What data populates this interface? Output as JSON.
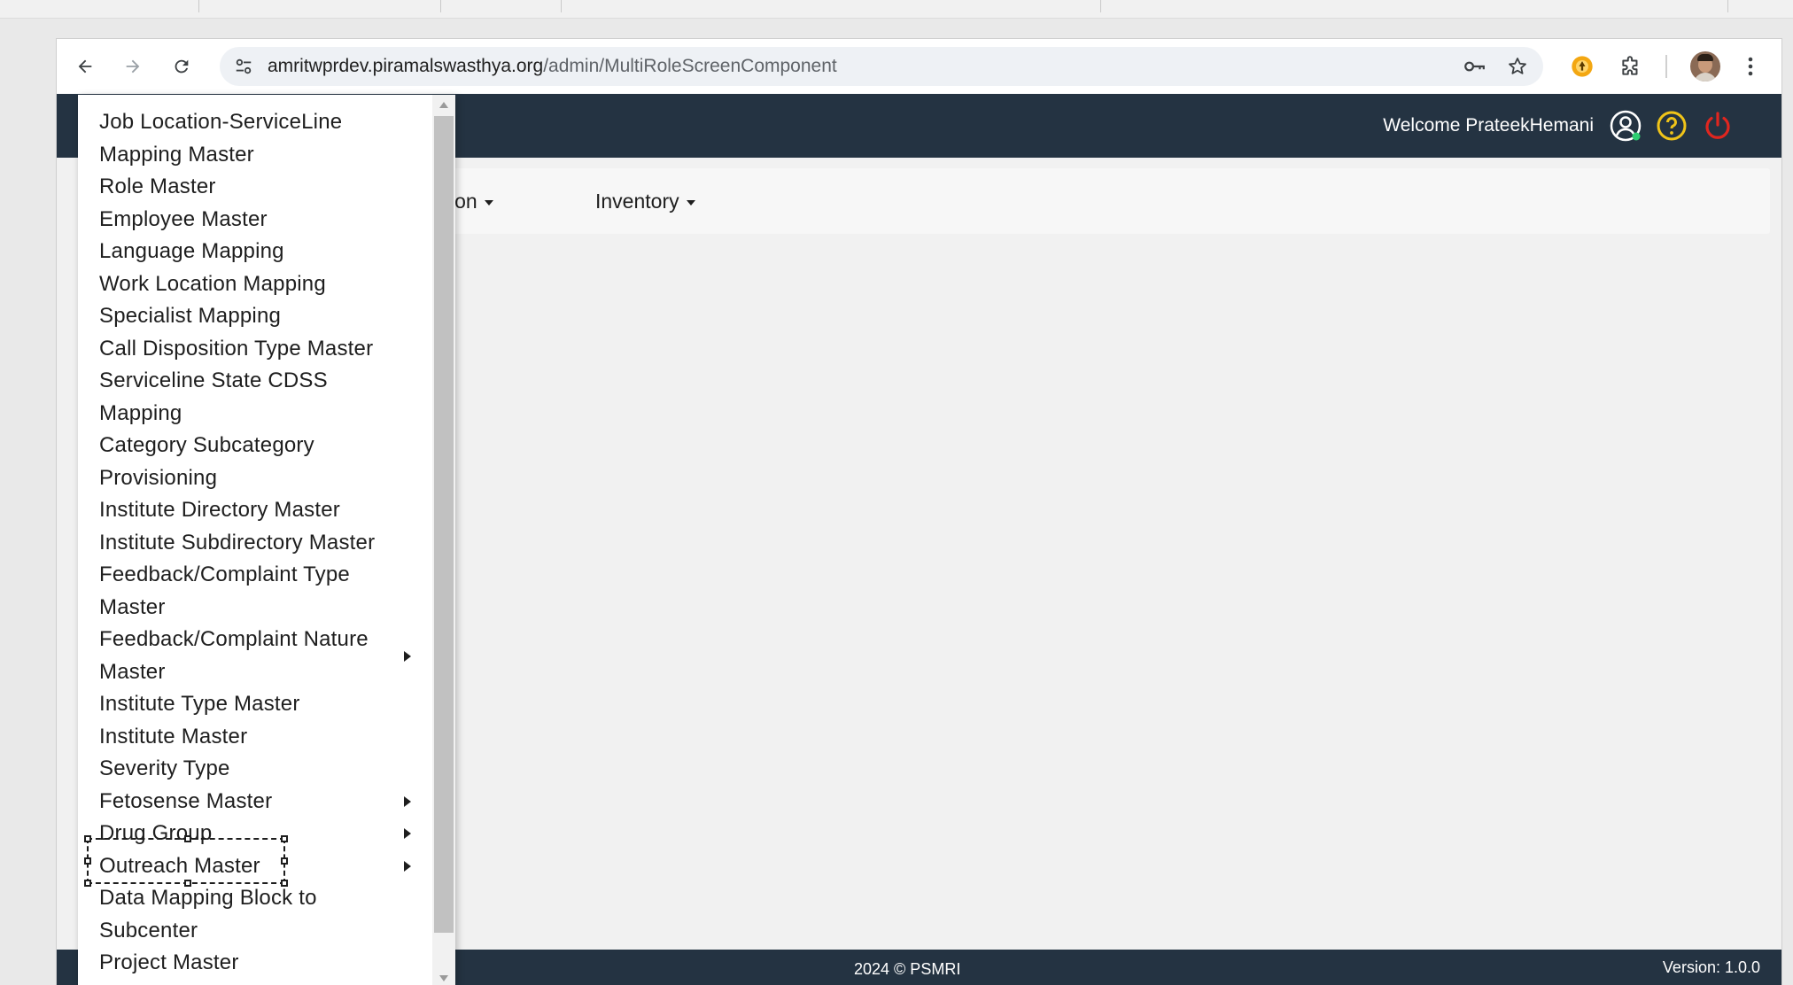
{
  "browser": {
    "url_host": "amritwprdev.piramalswasthya.org",
    "url_path": "/admin/MultiRoleScreenComponent",
    "back_icon": "arrow-left-icon",
    "forward_icon": "arrow-right-icon",
    "reload_icon": "reload-icon",
    "site_info_icon": "tune-icon",
    "password_icon": "key-icon",
    "bookmark_icon": "star-icon",
    "extension_icon": "puzzle-icon",
    "menu_icon": "vertical-dots-icon"
  },
  "header": {
    "welcome_text": "Welcome PrateekHemani",
    "icons": [
      "user-circle-icon",
      "help-icon",
      "power-icon"
    ],
    "colors": {
      "background": "#243342",
      "help": "#f0c419",
      "power": "#e0261f",
      "status_dot": "#2ecc71"
    }
  },
  "menubar": {
    "items": [
      {
        "label": "ion"
      },
      {
        "label": "Inventory"
      }
    ]
  },
  "dropdown": {
    "items": [
      {
        "lines": [
          "Job Location-ServiceLine",
          "Mapping Master"
        ],
        "has_submenu": false
      },
      {
        "lines": [
          "Role Master"
        ],
        "has_submenu": false
      },
      {
        "lines": [
          "Employee Master"
        ],
        "has_submenu": false
      },
      {
        "lines": [
          "Language Mapping"
        ],
        "has_submenu": false
      },
      {
        "lines": [
          "Work Location Mapping"
        ],
        "has_submenu": false
      },
      {
        "lines": [
          "Specialist Mapping"
        ],
        "has_submenu": false
      },
      {
        "lines": [
          "Call Disposition Type Master"
        ],
        "has_submenu": false
      },
      {
        "lines": [
          "Serviceline State CDSS",
          "Mapping"
        ],
        "has_submenu": false
      },
      {
        "lines": [
          "Category Subcategory",
          "Provisioning"
        ],
        "has_submenu": false
      },
      {
        "lines": [
          "Institute Directory Master"
        ],
        "has_submenu": false
      },
      {
        "lines": [
          "Institute Subdirectory Master"
        ],
        "has_submenu": false
      },
      {
        "lines": [
          "Feedback/Complaint Type",
          "Master"
        ],
        "has_submenu": false
      },
      {
        "lines": [
          "Feedback/Complaint Nature",
          "Master"
        ],
        "has_submenu": true
      },
      {
        "lines": [
          "Institute Type Master"
        ],
        "has_submenu": false
      },
      {
        "lines": [
          "Institute Master"
        ],
        "has_submenu": false
      },
      {
        "lines": [
          "Severity Type"
        ],
        "has_submenu": false
      },
      {
        "lines": [
          "Fetosense Master"
        ],
        "has_submenu": true
      },
      {
        "lines": [
          "Drug Group"
        ],
        "has_submenu": true
      },
      {
        "lines": [
          "Outreach Master"
        ],
        "has_submenu": true,
        "selected": true
      },
      {
        "lines": [
          "Data Mapping Block to",
          "Subcenter"
        ],
        "has_submenu": false
      },
      {
        "lines": [
          "Project Master"
        ],
        "has_submenu": false
      }
    ]
  },
  "footer": {
    "copyright": "2024 © PSMRI",
    "version": "Version: 1.0.0"
  }
}
